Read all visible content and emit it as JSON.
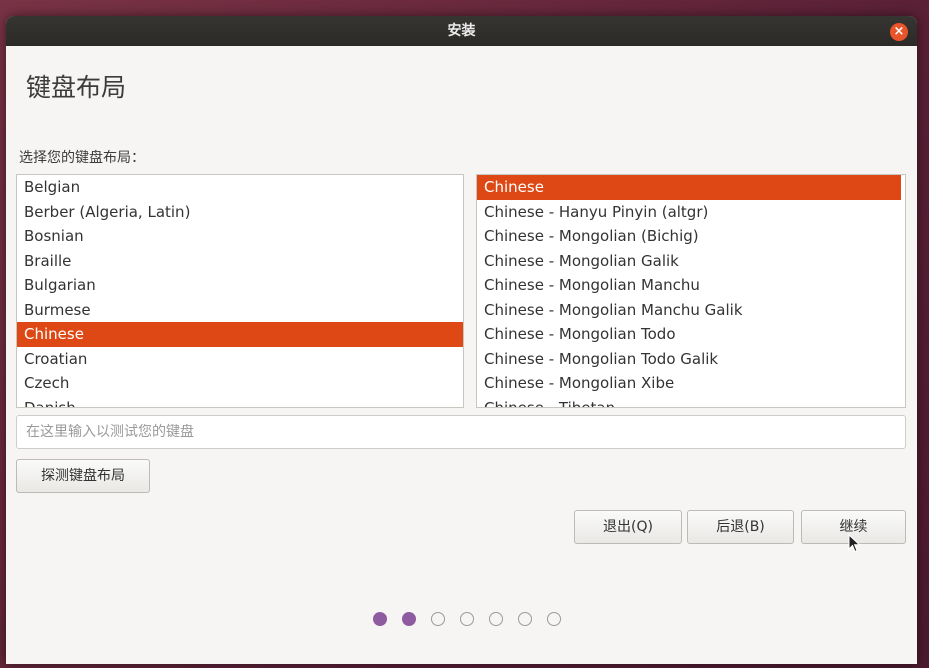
{
  "window": {
    "title": "安装",
    "close_glyph": "×"
  },
  "heading": "键盘布局",
  "prompt": "选择您的键盘布局：",
  "layouts": {
    "items": [
      "Belgian",
      "Berber (Algeria, Latin)",
      "Bosnian",
      "Braille",
      "Bulgarian",
      "Burmese",
      "Chinese",
      "Croatian",
      "Czech",
      "Danish"
    ],
    "selected": "Chinese"
  },
  "variants": {
    "items": [
      "Chinese",
      "Chinese - Hanyu Pinyin (altgr)",
      "Chinese - Mongolian (Bichig)",
      "Chinese - Mongolian Galik",
      "Chinese - Mongolian Manchu",
      "Chinese - Mongolian Manchu Galik",
      "Chinese - Mongolian Todo",
      "Chinese - Mongolian Todo Galik",
      "Chinese - Mongolian Xibe",
      "Chinese - Tibetan"
    ],
    "selected": "Chinese"
  },
  "test_input": {
    "placeholder": "在这里输入以测试您的键盘",
    "value": ""
  },
  "buttons": {
    "detect": "探测键盘布局",
    "quit": "退出(Q)",
    "back": "后退(B)",
    "continue": "继续"
  },
  "progress": {
    "total_steps": 7,
    "completed_steps": 2
  },
  "colors": {
    "accent": "#dd4814",
    "progress_dot": "#8e5ba1",
    "titlebar": "#2f2e2b"
  }
}
